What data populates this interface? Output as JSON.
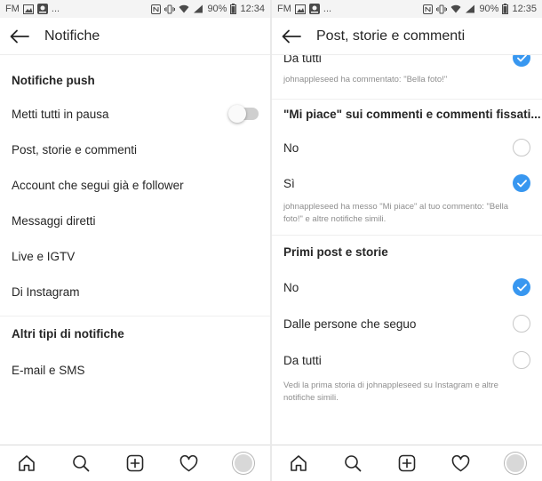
{
  "left": {
    "status": {
      "fm": "FM",
      "dots": "...",
      "battery": "90%",
      "time": "12:34"
    },
    "header": {
      "title": "Notifiche"
    },
    "push_section": "Notifiche push",
    "items": {
      "pause": "Metti tutti in pausa",
      "posts": "Post, storie e commenti",
      "following": "Account che segui già e follower",
      "direct": "Messaggi diretti",
      "live": "Live e IGTV",
      "instagram": "Di Instagram"
    },
    "pause_toggle_on": false,
    "other_section": "Altri tipi di notifiche",
    "email": "E-mail e SMS"
  },
  "right": {
    "status": {
      "fm": "FM",
      "dots": "...",
      "battery": "90%",
      "time": "12:35"
    },
    "header": {
      "title": "Post, storie e commenti"
    },
    "comments": {
      "option_everyone": "Da tutti",
      "example": "johnappleseed ha commentato: \"Bella foto!\""
    },
    "likes": {
      "title": "\"Mi piace\" sui commenti e commenti fissati...",
      "option_no": "No",
      "option_yes": "Sì",
      "example": "johnappleseed ha messo \"Mi piace\" al tuo commento: \"Bella foto!\" e altre notifiche simili."
    },
    "first_posts": {
      "title": "Primi post e storie",
      "option_no": "No",
      "option_following": "Dalle persone che seguo",
      "option_everyone": "Da tutti",
      "example": "Vedi la prima storia di johnappleseed su Instagram e altre notifiche simili."
    }
  },
  "tabbar_icons": [
    "home-icon",
    "search-icon",
    "add-post-icon",
    "activity-heart-icon",
    "profile-avatar"
  ],
  "colors": {
    "accent": "#3897f0",
    "text": "#262626",
    "secondary_text": "#8e8e8e",
    "divider": "#efefef"
  }
}
